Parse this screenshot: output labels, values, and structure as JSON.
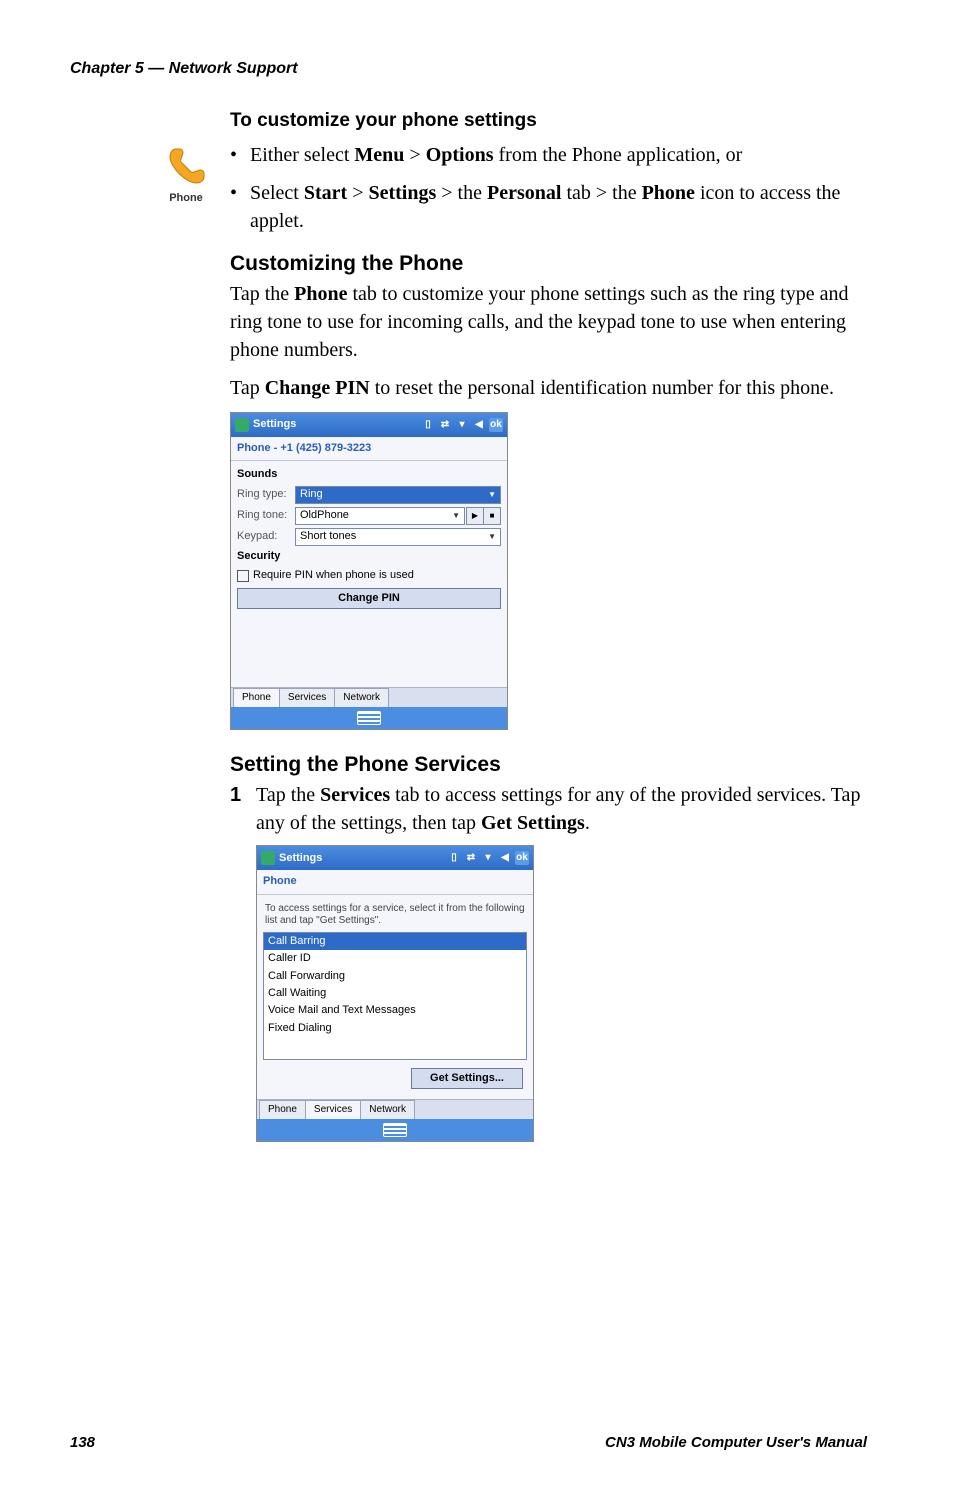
{
  "header": "Chapter 5 — Network Support",
  "title": "To customize your phone settings",
  "phone_icon_label": "Phone",
  "bullets": {
    "b1_pre": "Either select ",
    "b1_menu": "Menu",
    "b1_gt1": " > ",
    "b1_options": "Options",
    "b1_post": " from the Phone application, or",
    "b2_pre": "Select ",
    "b2_start": "Start",
    "b2_gt1": " > ",
    "b2_settings": "Settings",
    "b2_gt2": " > the ",
    "b2_personal": "Personal",
    "b2_mid": " tab > the ",
    "b2_phone": "Phone",
    "b2_post": " icon to access the applet."
  },
  "custom": {
    "heading": "Customizing the Phone",
    "p1_pre": "Tap the ",
    "p1_phone": "Phone",
    "p1_post": " tab to customize your phone settings such as the ring type and ring tone to use for incoming calls, and the keypad tone to use when entering phone numbers.",
    "p2_pre": "Tap ",
    "p2_bold": "Change PIN",
    "p2_post": " to reset the personal identification number for this phone."
  },
  "ss1": {
    "title": "Settings",
    "ok": "ok",
    "subtitle": "Phone - +1 (425) 879-3223",
    "sounds": "Sounds",
    "ringtype_lbl": "Ring type:",
    "ringtype_val": "Ring",
    "ringtone_lbl": "Ring tone:",
    "ringtone_val": "OldPhone",
    "keypad_lbl": "Keypad:",
    "keypad_val": "Short tones",
    "security": "Security",
    "reqpin": "Require PIN when phone is used",
    "changepin": "Change PIN",
    "tab_phone": "Phone",
    "tab_services": "Services",
    "tab_network": "Network"
  },
  "services": {
    "heading": "Setting the Phone Services",
    "step1_pre": "Tap the ",
    "step1_bold": "Services",
    "step1_mid": " tab to access settings for any of the provided services. Tap any of the settings, then tap ",
    "step1_bold2": "Get Settings",
    "step1_post": "."
  },
  "ss2": {
    "title": "Settings",
    "ok": "ok",
    "subtitle": "Phone",
    "help": "To access settings for a service, select it from the following list and tap \"Get Settings\".",
    "items": [
      "Call Barring",
      "Caller ID",
      "Call Forwarding",
      "Call Waiting",
      "Voice Mail and Text Messages",
      "Fixed Dialing"
    ],
    "getsettings": "Get Settings...",
    "tab_phone": "Phone",
    "tab_services": "Services",
    "tab_network": "Network"
  },
  "footer": {
    "page": "138",
    "manual": "CN3 Mobile Computer User's Manual"
  }
}
